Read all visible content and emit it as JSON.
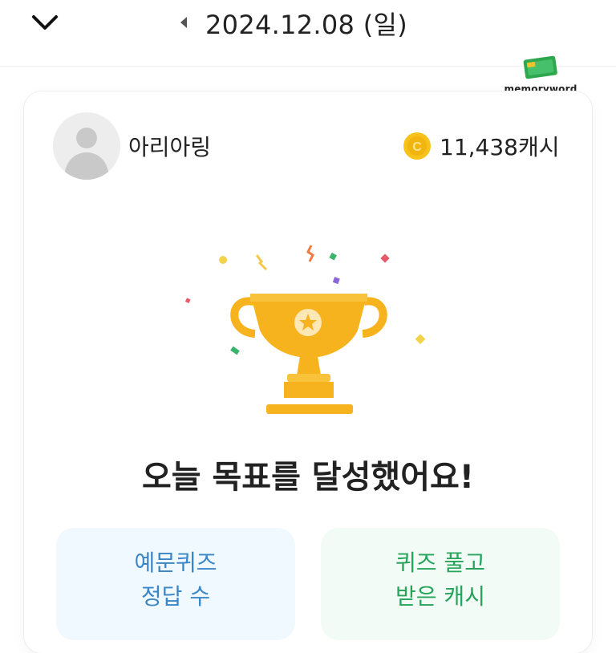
{
  "header": {
    "date": "2024.12.08 (일)",
    "back_icon": "chevron-down-icon",
    "prev_icon": "caret-left-icon"
  },
  "logo": {
    "text": "memoryword"
  },
  "profile": {
    "name": "아리아링",
    "cash": "11,438캐시",
    "coin_icon": "coin-icon"
  },
  "main": {
    "headline": "오늘 목표를 달성했어요!"
  },
  "stats": {
    "left_line1": "예문퀴즈",
    "left_line2": "정답 수",
    "right_line1": "퀴즈 풀고",
    "right_line2": "받은 캐시"
  },
  "colors": {
    "trophy": "#F6B31E",
    "coin": "#F7C21A",
    "blue_text": "#3A86C6",
    "green_text": "#25A45A"
  }
}
